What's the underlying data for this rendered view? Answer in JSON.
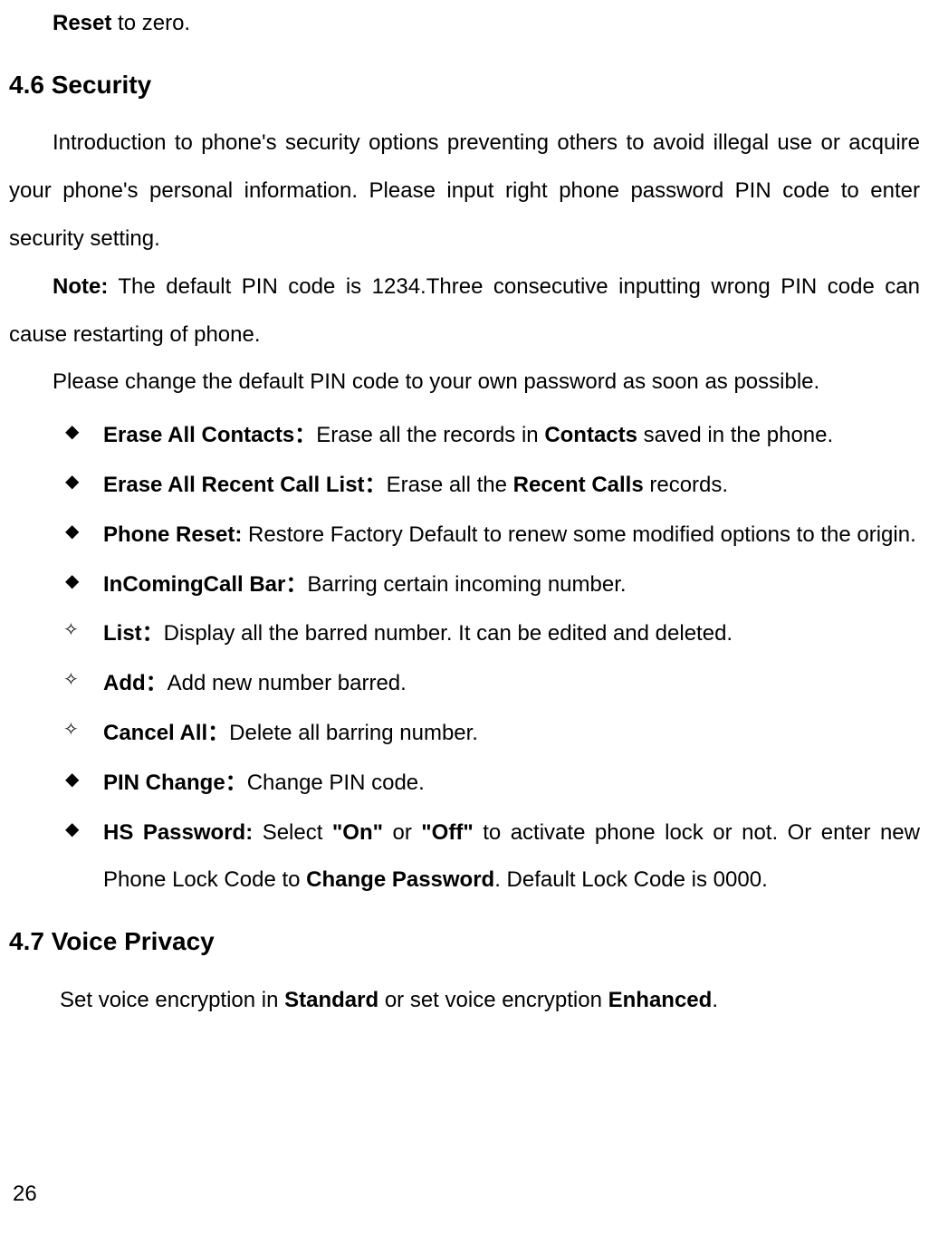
{
  "line1_bold": "Reset",
  "line1_rest": " to zero.",
  "section46": "4.6 Security",
  "intro_text_a": "Introduction to phone's security options preventing others to avoid illegal use or acquire your phone's personal information. Please input right phone password PIN code to enter security setting.",
  "note_bold": "Note:",
  "note_text": " The default PIN code is 1234.Three consecutive inputting wrong PIN code can cause restarting of phone.",
  "please_text": "Please change the default PIN code to your own password as soon as possible.",
  "bullets": {
    "b1_bold": "Erase All Contacts：",
    "b1_rest1": "Erase all the records in ",
    "b1_bold2": "Contacts",
    "b1_rest2": " saved in the phone.",
    "b2_bold": "Erase All Recent Call List：",
    "b2_rest1": "Erase all the ",
    "b2_bold2": "Recent Calls",
    "b2_rest2": " records.",
    "b3_bold": "Phone Reset:",
    "b3_rest": " Restore Factory Default to renew some modified options to the origin.",
    "b4_bold": "InComingCall Bar：",
    "b4_rest": "Barring certain incoming number.",
    "b5_bold": "List：",
    "b5_rest": "Display all the barred number. It can be edited and deleted.",
    "b6_bold": "Add：",
    "b6_rest": "Add new number barred.",
    "b7_bold": "Cancel All：",
    "b7_rest": "Delete all barring number.",
    "b8_bold": "PIN Change：",
    "b8_rest": "Change PIN code.",
    "b9_bold": "HS Password:",
    "b9_rest1": " Select ",
    "b9_bold2": "\"On\"",
    "b9_rest2": " or ",
    "b9_bold3": "\"Off\"",
    "b9_rest3": " to activate phone lock or not. Or enter new Phone Lock Code to ",
    "b9_bold4": "Change Password",
    "b9_rest4": ". Default Lock Code is 0000."
  },
  "section47": "4.7 Voice Privacy",
  "voice_text1": "Set voice encryption in ",
  "voice_bold1": "Standard",
  "voice_text2": " or set voice encryption ",
  "voice_bold2": "Enhanced",
  "voice_text3": ".",
  "page_number": "26"
}
